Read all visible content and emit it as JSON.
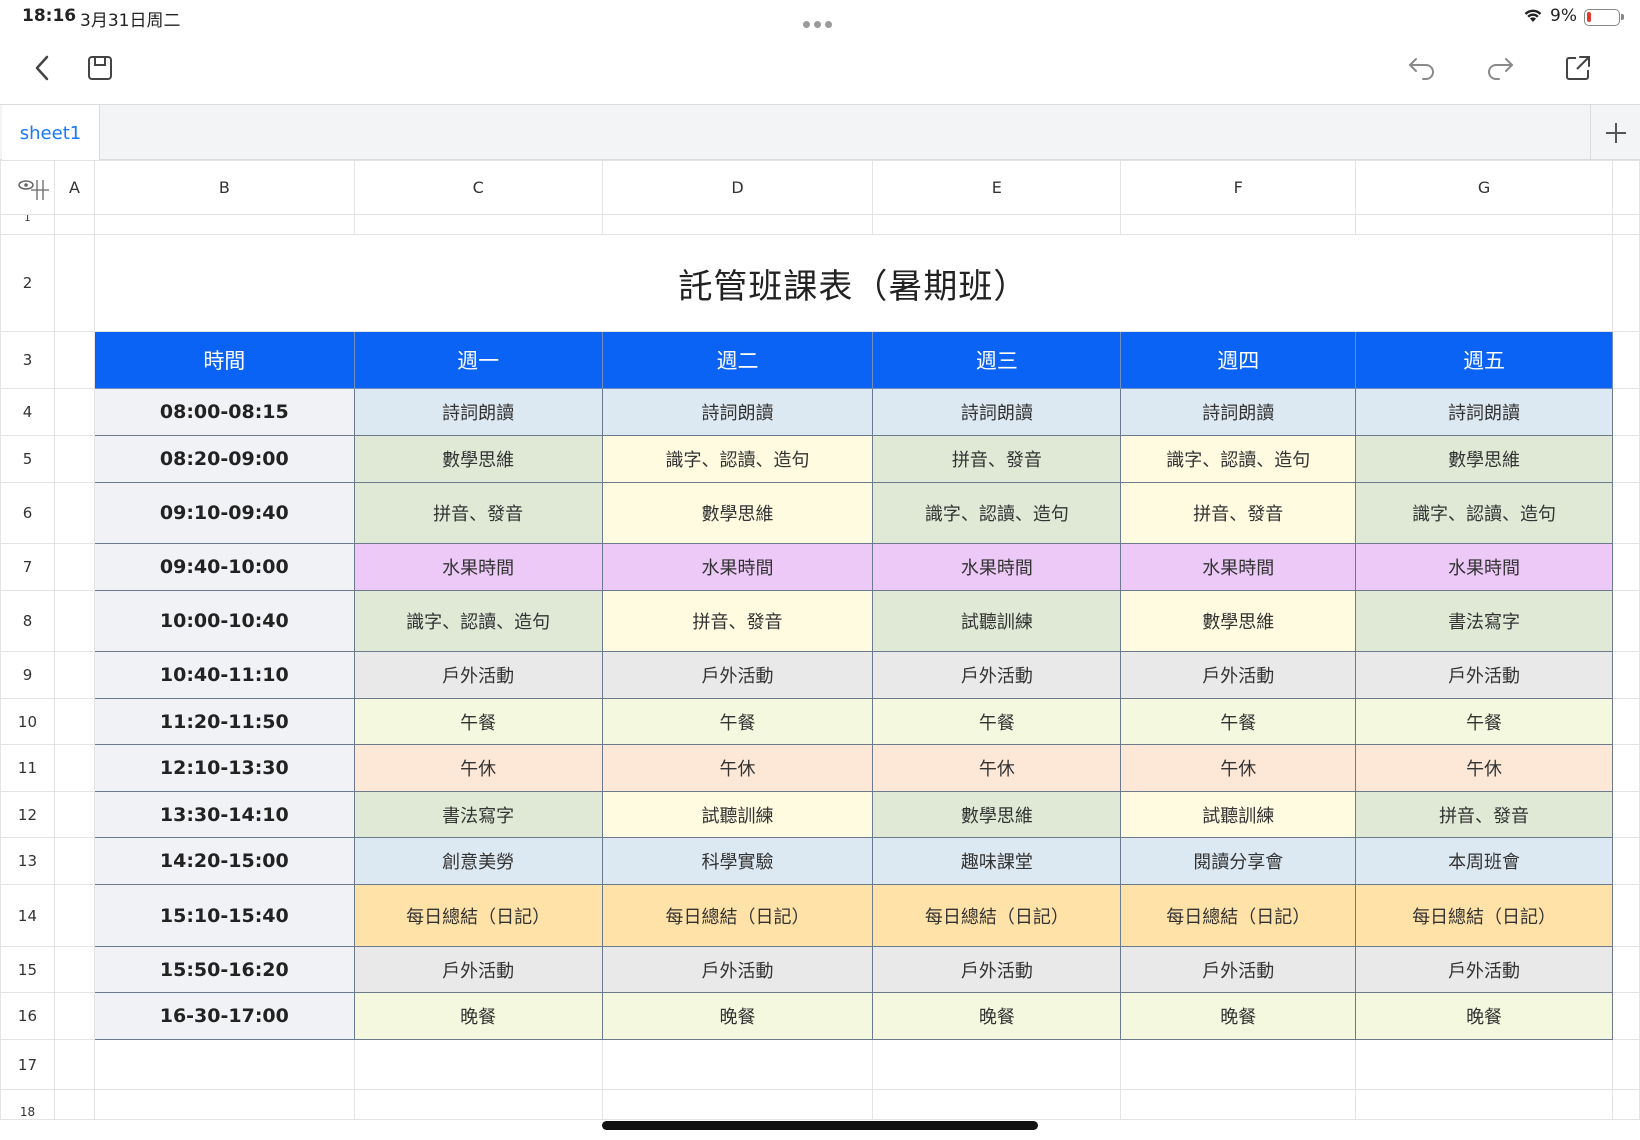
{
  "status": {
    "time": "18:16",
    "date": "3月31日周二",
    "battery": "9%"
  },
  "toolbar": {
    "back": "back-icon",
    "save": "save-icon",
    "undo": "undo-icon",
    "redo": "redo-icon",
    "share": "share-icon"
  },
  "tabs": {
    "active": "sheet1",
    "add": "+"
  },
  "columns": [
    "A",
    "B",
    "C",
    "D",
    "E",
    "F",
    "G"
  ],
  "title": "託管班課表（暑期班）",
  "header": [
    "時間",
    "週一",
    "週二",
    "週三",
    "週四",
    "週五"
  ],
  "rows": [
    {
      "num": "4",
      "time": "08:00-08:15",
      "cells": [
        "詩詞朗讀",
        "詩詞朗讀",
        "詩詞朗讀",
        "詩詞朗讀",
        "詩詞朗讀"
      ]
    },
    {
      "num": "5",
      "time": "08:20-09:00",
      "cells": [
        "數學思維",
        "識字、認讀、造句",
        "拼音、發音",
        "識字、認讀、造句",
        "數學思維"
      ]
    },
    {
      "num": "6",
      "time": "09:10-09:40",
      "cells": [
        "拼音、發音",
        "數學思維",
        "識字、認讀、造句",
        "拼音、發音",
        "識字、認讀、造句"
      ]
    },
    {
      "num": "7",
      "time": "09:40-10:00",
      "cells": [
        "水果時間",
        "水果時間",
        "水果時間",
        "水果時間",
        "水果時間"
      ]
    },
    {
      "num": "8",
      "time": "10:00-10:40",
      "cells": [
        "識字、認讀、造句",
        "拼音、發音",
        "試聽訓練",
        "數學思維",
        "書法寫字"
      ]
    },
    {
      "num": "9",
      "time": "10:40-11:10",
      "cells": [
        "戶外活動",
        "戶外活動",
        "戶外活動",
        "戶外活動",
        "戶外活動"
      ]
    },
    {
      "num": "10",
      "time": "11:20-11:50",
      "cells": [
        "午餐",
        "午餐",
        "午餐",
        "午餐",
        "午餐"
      ]
    },
    {
      "num": "11",
      "time": "12:10-13:30",
      "cells": [
        "午休",
        "午休",
        "午休",
        "午休",
        "午休"
      ]
    },
    {
      "num": "12",
      "time": "13:30-14:10",
      "cells": [
        "書法寫字",
        "試聽訓練",
        "數學思維",
        "試聽訓練",
        "拼音、發音"
      ]
    },
    {
      "num": "13",
      "time": "14:20-15:00",
      "cells": [
        "創意美勞",
        "科學實驗",
        "趣味課堂",
        "閱讀分享會",
        "本周班會"
      ]
    },
    {
      "num": "14",
      "time": "15:10-15:40",
      "cells": [
        "每日總結（日記）",
        "每日總結（日記）",
        "每日總結（日記）",
        "每日總結（日記）",
        "每日總結（日記）"
      ]
    },
    {
      "num": "15",
      "time": "15:50-16:20",
      "cells": [
        "戶外活動",
        "戶外活動",
        "戶外活動",
        "戶外活動",
        "戶外活動"
      ]
    },
    {
      "num": "16",
      "time": "16-30-17:00",
      "cells": [
        "晚餐",
        "晚餐",
        "晚餐",
        "晚餐",
        "晚餐"
      ]
    }
  ],
  "row_labels": {
    "r1": "1",
    "r2": "2",
    "r3": "3",
    "r17": "17",
    "r18": "18"
  },
  "colors": {
    "header_blue": "#0a63f5",
    "tab_blue": "#1677ff"
  }
}
